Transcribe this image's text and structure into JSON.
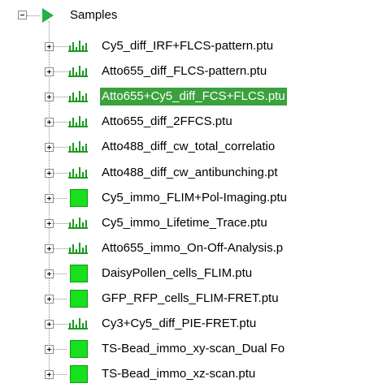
{
  "tree": {
    "root": {
      "label": "Samples",
      "expander": "minus",
      "icon": "green-play-icon"
    },
    "items": [
      {
        "label": "Cy5_diff_IRF+FLCS-pattern.ptu",
        "icon": "histogram-icon",
        "selected": false
      },
      {
        "label": "Atto655_diff_FLCS-pattern.ptu",
        "icon": "histogram-icon",
        "selected": false
      },
      {
        "label": "Atto655+Cy5_diff_FCS+FLCS.ptu",
        "icon": "histogram-icon",
        "selected": true
      },
      {
        "label": "Atto655_diff_2FFCS.ptu",
        "icon": "histogram-icon",
        "selected": false
      },
      {
        "label": "Atto488_diff_cw_total_correlatio",
        "icon": "histogram-icon",
        "selected": false
      },
      {
        "label": "Atto488_diff_cw_antibunching.pt",
        "icon": "histogram-icon",
        "selected": false
      },
      {
        "label": "Cy5_immo_FLIM+Pol-Imaging.ptu",
        "icon": "green-square-icon",
        "selected": false
      },
      {
        "label": "Cy5_immo_Lifetime_Trace.ptu",
        "icon": "histogram-icon",
        "selected": false
      },
      {
        "label": "Atto655_immo_On-Off-Analysis.p",
        "icon": "histogram-icon",
        "selected": false
      },
      {
        "label": "DaisyPollen_cells_FLIM.ptu",
        "icon": "green-square-icon",
        "selected": false
      },
      {
        "label": "GFP_RFP_cells_FLIM-FRET.ptu",
        "icon": "green-square-icon",
        "selected": false
      },
      {
        "label": "Cy3+Cy5_diff_PIE-FRET.ptu",
        "icon": "histogram-icon",
        "selected": false
      },
      {
        "label": "TS-Bead_immo_xy-scan_Dual Fo",
        "icon": "green-square-icon",
        "selected": false
      },
      {
        "label": "TS-Bead_immo_xz-scan.ptu",
        "icon": "green-square-icon",
        "selected": false
      }
    ]
  },
  "colors": {
    "selection_bg": "#3aa13d",
    "selection_text": "#ffffff",
    "icon_green": "#17e01c",
    "play_green": "#22b14c",
    "histogram_green": "#1d9a21"
  }
}
